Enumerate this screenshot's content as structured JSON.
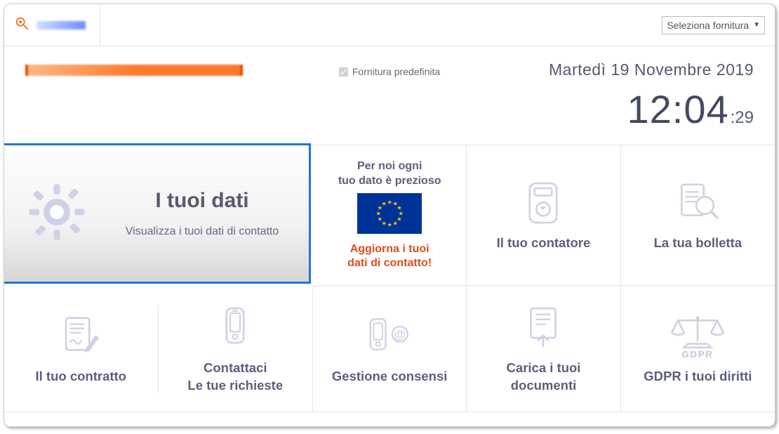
{
  "header": {
    "supply_selector_label": "Seleziona fornitura",
    "default_supply_label": "Fornitura predefinita",
    "default_supply_checked": true,
    "date_text": "Martedì 19 Novembre 2019",
    "time_main": "12:04",
    "time_seconds": ":29"
  },
  "tiles": {
    "primary": {
      "title": "I tuoi dati",
      "subtitle": "Visualizza i tuoi dati di contatto"
    },
    "promo": {
      "line1": "Per noi ogni",
      "line2": "tuo dato è prezioso",
      "line3": "Aggiorna i tuoi",
      "line4": "dati di contatto!"
    },
    "meter": {
      "title": "Il tuo contatore"
    },
    "bill": {
      "title": "La tua bolletta"
    },
    "contract": {
      "title": "Il tuo contratto"
    },
    "contact": {
      "title_l1": "Contattaci",
      "title_l2": "Le tue richieste"
    },
    "consent": {
      "title": "Gestione consensi"
    },
    "upload": {
      "title_l1": "Carica i tuoi",
      "title_l2": "documenti"
    },
    "gdpr": {
      "title": "GDPR i tuoi diritti",
      "badge": "GDPR"
    }
  }
}
